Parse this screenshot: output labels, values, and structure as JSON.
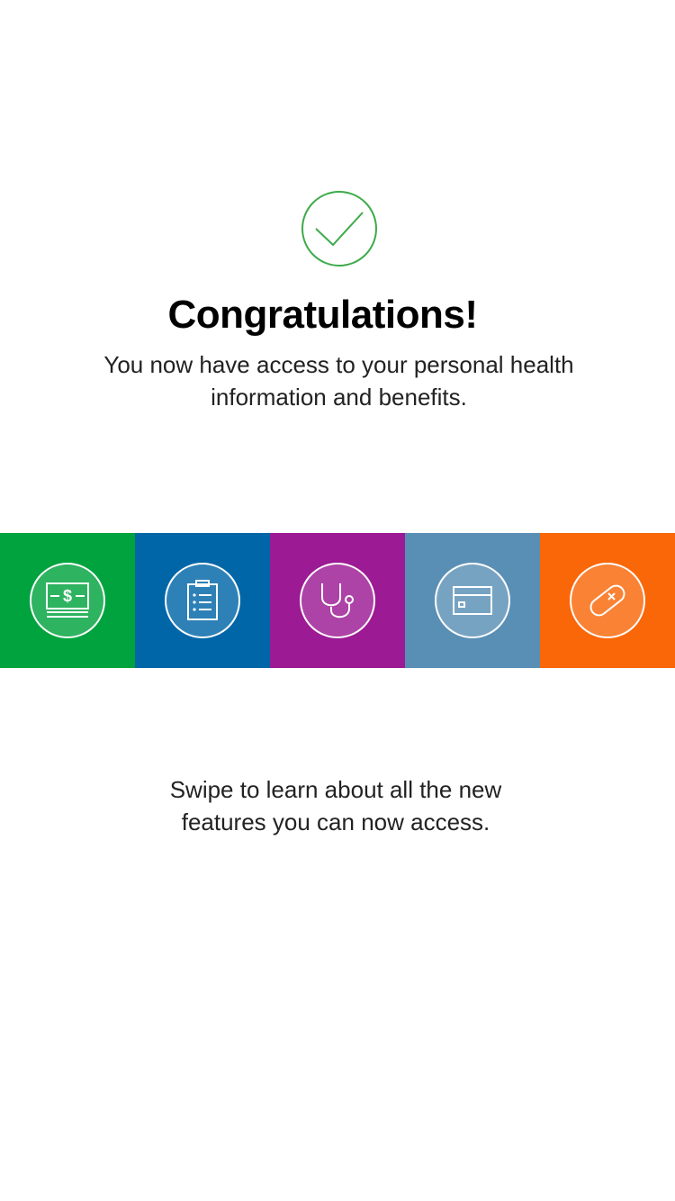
{
  "success": {
    "icon": "checkmark-circle-icon",
    "title": "Congratulations!",
    "message": "You now have access to your personal health information and benefits."
  },
  "features": [
    {
      "name": "claims",
      "icon": "dollar-bill-icon",
      "color": "#00A33D"
    },
    {
      "name": "clipboard",
      "icon": "clipboard-list-icon",
      "color": "#0066A8"
    },
    {
      "name": "care",
      "icon": "stethoscope-icon",
      "color": "#9C1A93"
    },
    {
      "name": "card",
      "icon": "id-card-icon",
      "color": "#5A8FB5"
    },
    {
      "name": "pharmacy",
      "icon": "pill-icon",
      "color": "#F96709"
    }
  ],
  "swipe_hint": "Swipe to learn about all the new features you can now access.",
  "colors": {
    "check": "#3DAA4A"
  }
}
